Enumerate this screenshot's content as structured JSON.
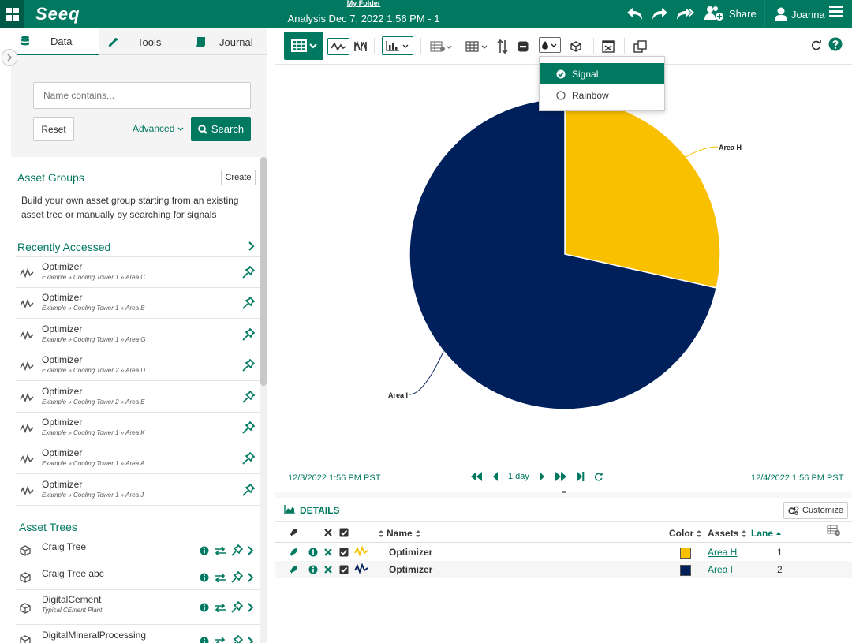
{
  "header": {
    "logo": "Seeq",
    "folder_link": "My Folder",
    "analysis_title": "Analysis Dec 7, 2022 1:56 PM - 1",
    "share_label": "Share",
    "user_name": "Joanna"
  },
  "left_panel": {
    "tabs": [
      {
        "label": "Data",
        "icon": "database-icon"
      },
      {
        "label": "Tools",
        "icon": "wrench-icon"
      },
      {
        "label": "Journal",
        "icon": "book-icon"
      }
    ],
    "search": {
      "placeholder": "Name contains...",
      "reset_label": "Reset",
      "advanced_label": "Advanced",
      "search_label": "Search"
    },
    "asset_groups": {
      "title": "Asset Groups",
      "create_label": "Create",
      "description": "Build your own asset group starting from an existing asset tree or manually by searching for signals"
    },
    "recently_accessed": {
      "title": "Recently Accessed",
      "items": [
        {
          "name": "Optimizer",
          "path": "Example » Cooling Tower 1 » Area C"
        },
        {
          "name": "Optimizer",
          "path": "Example » Cooling Tower 1 » Area B"
        },
        {
          "name": "Optimizer",
          "path": "Example » Cooling Tower 1 » Area G"
        },
        {
          "name": "Optimizer",
          "path": "Example » Cooling Tower 2 » Area D"
        },
        {
          "name": "Optimizer",
          "path": "Example » Cooling Tower 2 » Area E"
        },
        {
          "name": "Optimizer",
          "path": "Example » Cooling Tower 1 » Area K"
        },
        {
          "name": "Optimizer",
          "path": "Example » Cooling Tower 1 » Area A"
        },
        {
          "name": "Optimizer",
          "path": "Example » Cooling Tower 1 » Area J"
        }
      ]
    },
    "asset_trees": {
      "title": "Asset Trees",
      "items": [
        {
          "name": "Craig Tree",
          "sub": ""
        },
        {
          "name": "Craig Tree abc",
          "sub": ""
        },
        {
          "name": "DigitalCement",
          "sub": "Typical CEment Plant"
        },
        {
          "name": "DigitalMineralProcessing",
          "sub": ""
        }
      ]
    }
  },
  "color_dropdown": {
    "options": [
      {
        "label": "Signal",
        "selected": true
      },
      {
        "label": "Rainbow",
        "selected": false
      }
    ]
  },
  "chart_data": {
    "type": "pie",
    "categories": [
      "Area H",
      "Area I"
    ],
    "values": [
      28.5,
      71.5
    ],
    "colors": [
      "#F9C000",
      "#00205C"
    ]
  },
  "time_bar": {
    "start": "12/3/2022 1:56 PM  PST",
    "end": "12/4/2022 1:56 PM  PST",
    "duration": "1 day"
  },
  "details": {
    "title": "DETAILS",
    "customize_label": "Customize",
    "columns": {
      "name": "Name",
      "color": "Color",
      "assets": "Assets",
      "lane": "Lane"
    },
    "rows": [
      {
        "name": "Optimizer",
        "color": "#F9C000",
        "asset": "Area H",
        "lane": "1"
      },
      {
        "name": "Optimizer",
        "color": "#00205C",
        "asset": "Area I",
        "lane": "2"
      }
    ]
  }
}
